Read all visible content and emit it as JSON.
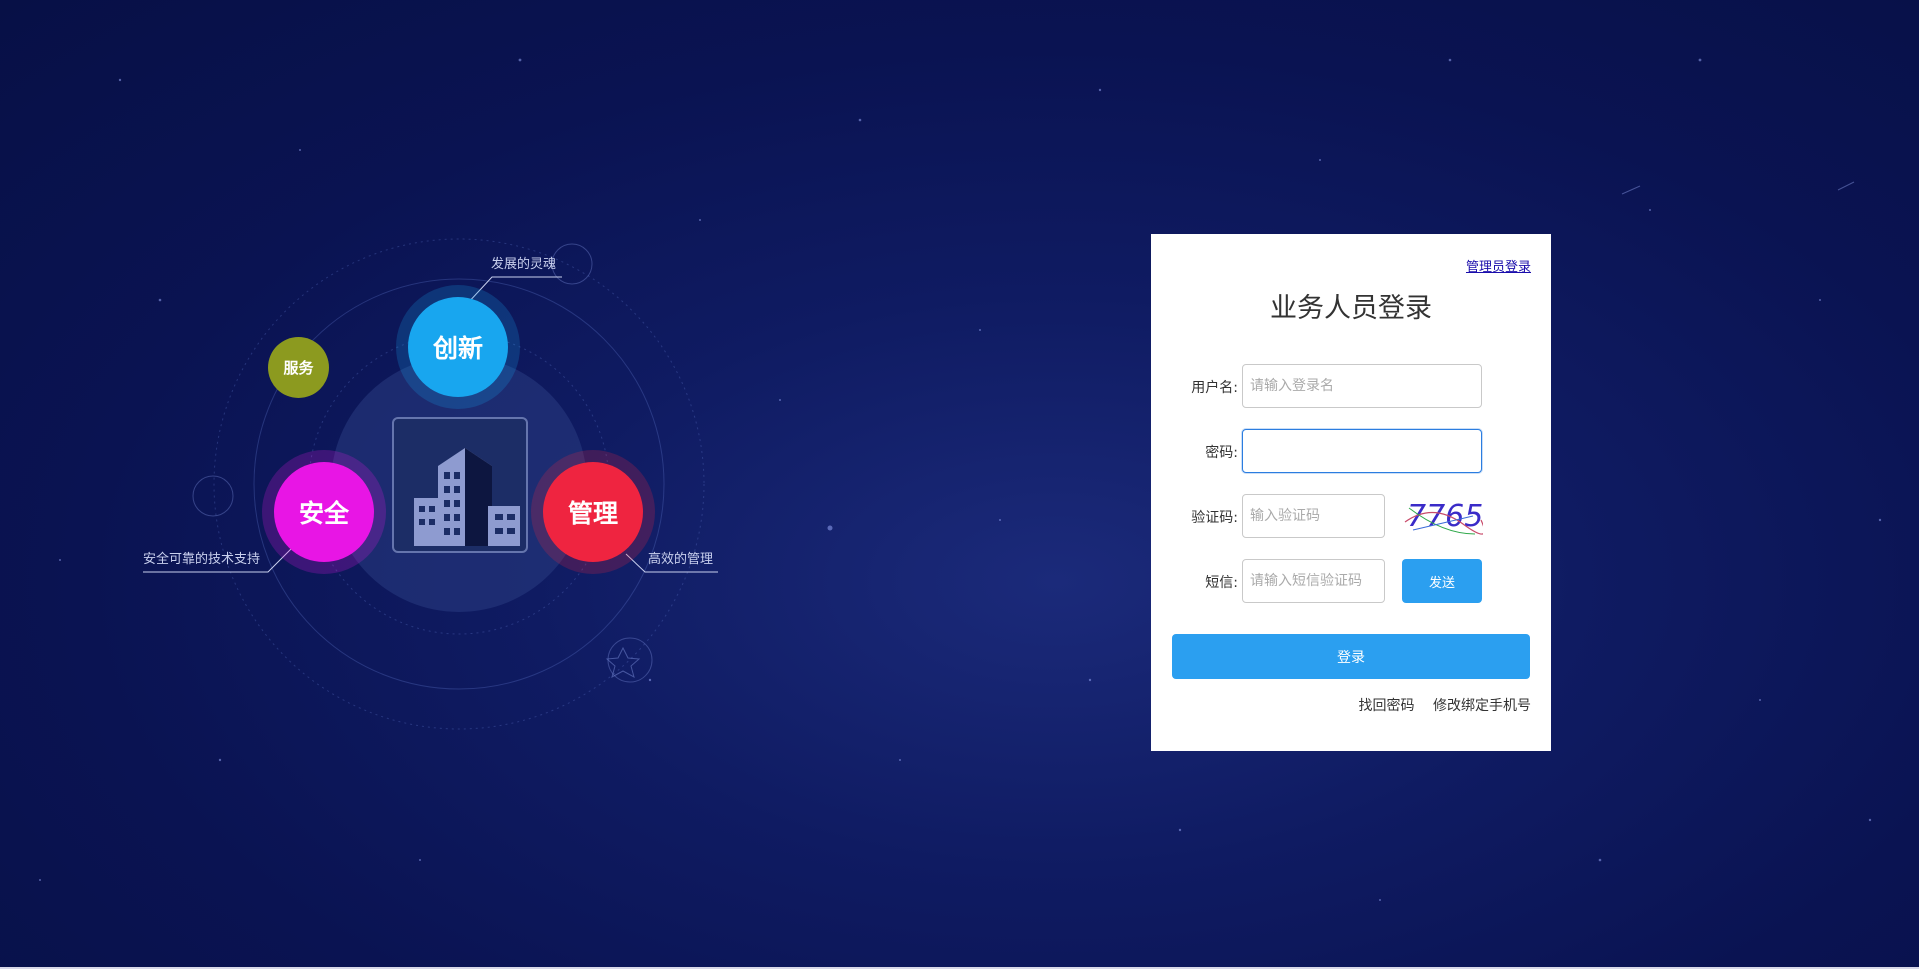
{
  "illustration": {
    "circles": {
      "innovation": "创新",
      "service": "服务",
      "security": "安全",
      "management": "管理"
    },
    "captions": {
      "soul": "发展的灵魂",
      "tech": "安全可靠的技术支持",
      "mgmt": "高效的管理"
    }
  },
  "login": {
    "admin_link": "管理员登录",
    "title": "业务人员登录",
    "username_label": "用户名:",
    "username_placeholder": "请输入登录名",
    "password_label": "密码:",
    "password_value": "",
    "captcha_label": "验证码:",
    "captcha_placeholder": "输入验证码",
    "captcha_code": "7765",
    "sms_label": "短信:",
    "sms_placeholder": "请输入短信验证码",
    "send_label": "发送",
    "login_label": "登录",
    "forgot_password": "找回密码",
    "change_phone": "修改绑定手机号"
  },
  "colors": {
    "background": "#0a1352",
    "innovation": "#18a6ef",
    "security": "#e815e5",
    "management": "#ef2440",
    "service": "#8c9a1f",
    "button": "#2b9ff0"
  }
}
